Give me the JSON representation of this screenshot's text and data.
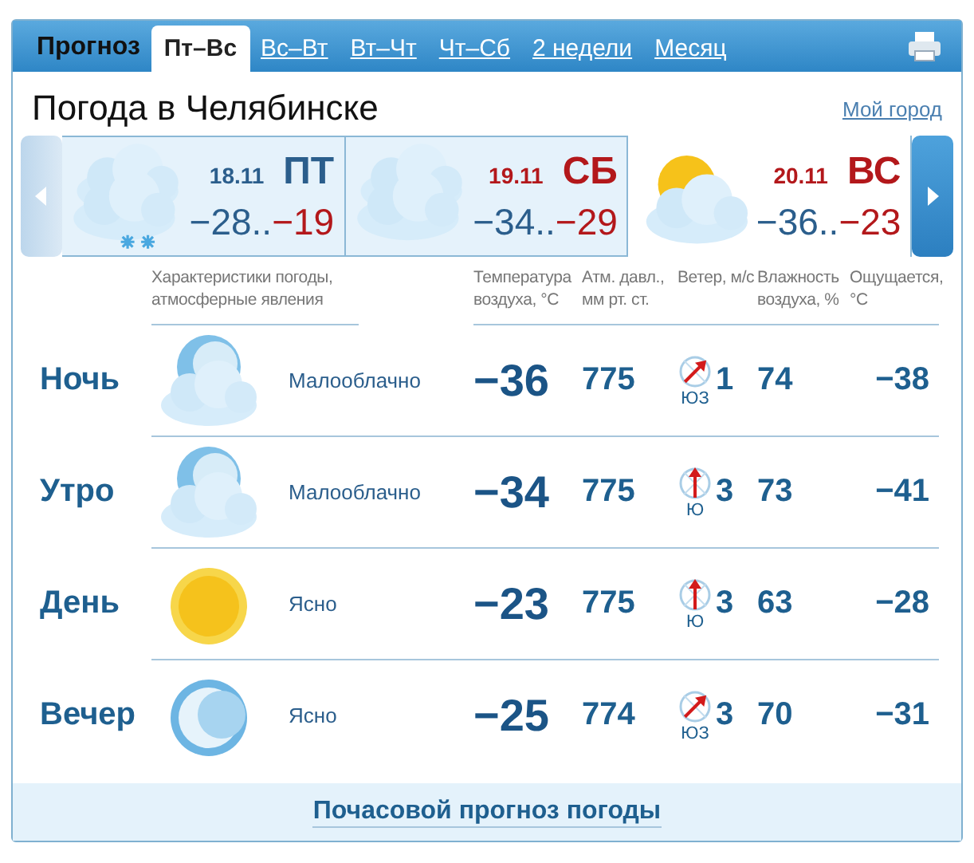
{
  "tabs": [
    {
      "label": "Прогноз",
      "kind": "title",
      "selected": false
    },
    {
      "label": "Пт–Вс",
      "kind": "tab",
      "selected": true
    },
    {
      "label": "Вс–Вт",
      "kind": "tab",
      "selected": false
    },
    {
      "label": "Вт–Чт",
      "kind": "tab",
      "selected": false
    },
    {
      "label": "Чт–Сб",
      "kind": "tab",
      "selected": false
    },
    {
      "label": "2 недели",
      "kind": "tab",
      "selected": false
    },
    {
      "label": "Месяц",
      "kind": "tab",
      "selected": false
    }
  ],
  "title": "Погода в Челябинске",
  "my_city": "Мой город",
  "days": [
    {
      "date": "18.11",
      "weekday": "ПТ",
      "weekend": false,
      "selected": true,
      "min": "−28..",
      "max": "−19"
    },
    {
      "date": "19.11",
      "weekday": "СБ",
      "weekend": true,
      "selected": true,
      "min": "−34..",
      "max": "−29"
    },
    {
      "date": "20.11",
      "weekday": "ВС",
      "weekend": true,
      "selected": false,
      "min": "−36..",
      "max": "−23"
    }
  ],
  "columns": [
    "Характеристики погоды, атмосферные явления",
    "Температура воздуха, °C",
    "Атм. давл., мм рт. ст.",
    "Ветер, м/с",
    "Влажность воздуха, %",
    "Ощущается, °C"
  ],
  "rows": [
    {
      "period": "Ночь",
      "description": "Малооблачно",
      "temperature": "−36",
      "pressure": "775",
      "wind_dir": "ЮЗ",
      "wind_speed": "1",
      "humidity": "74",
      "feels": "−38"
    },
    {
      "period": "Утро",
      "description": "Малооблачно",
      "temperature": "−34",
      "pressure": "775",
      "wind_dir": "Ю",
      "wind_speed": "3",
      "humidity": "73",
      "feels": "−41"
    },
    {
      "period": "День",
      "description": "Ясно",
      "temperature": "−23",
      "pressure": "775",
      "wind_dir": "Ю",
      "wind_speed": "3",
      "humidity": "63",
      "feels": "−28"
    },
    {
      "period": "Вечер",
      "description": "Ясно",
      "temperature": "−25",
      "pressure": "774",
      "wind_dir": "ЮЗ",
      "wind_speed": "3",
      "humidity": "70",
      "feels": "−31"
    }
  ],
  "footer_link": "Почасовой прогноз погоды"
}
